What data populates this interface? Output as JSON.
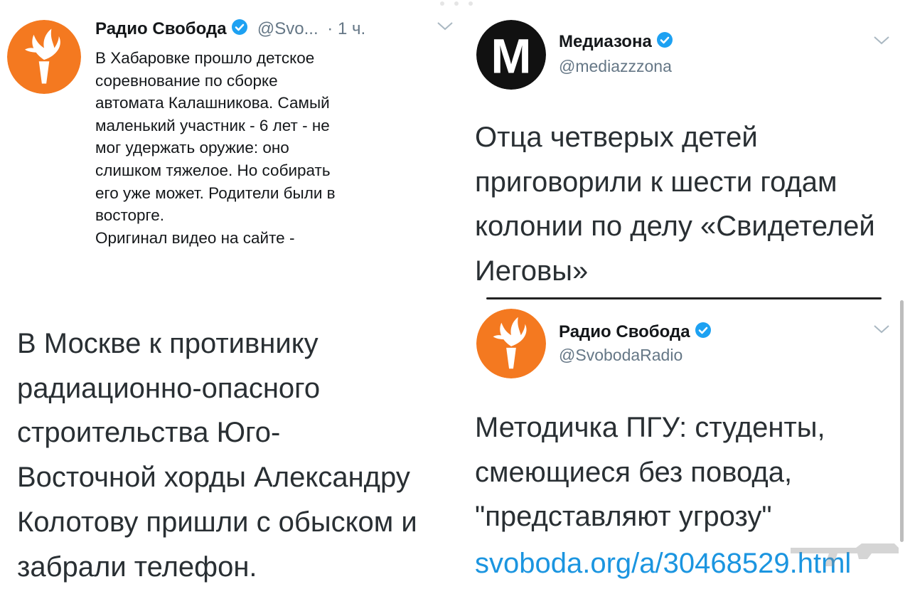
{
  "tweet_left": {
    "author_name": "Радио Свобода",
    "handle": "@Svo...",
    "time": "· 1 ч.",
    "body": [
      "В Хабаровке прошло детское",
      "соревнование по сборке",
      "автомата Калашникова. Самый",
      "маленький участник - 6 лет - не",
      "мог удержать оружие: оно",
      "слишком тяжелое. Но собирать",
      "его уже может. Родители были в",
      "восторге.",
      "Оригинал видео на сайте -"
    ]
  },
  "left_big_text": [
    "В Москве к противнику",
    "радиационно-опасного",
    "строительства Юго-",
    "Восточной хорды Александру",
    "Колотову пришли с обыском и",
    "забрали телефон."
  ],
  "tweet_right_top": {
    "author_name": "Медиазона",
    "handle": "@mediazzzona",
    "avatar_letter": "M",
    "body": [
      "Отца четверых детей",
      "приговорили к шести годам",
      "колонии по делу «Свидетелей",
      "Иеговы»"
    ]
  },
  "tweet_right_bottom": {
    "author_name": "Радио Свобода",
    "handle": "@SvobodaRadio",
    "body": [
      "Методичка ПГУ: студенты,",
      "смеющиеся без повода,",
      "\"представляют угрозу\""
    ],
    "link": "svoboda.org/a/30468529.html"
  },
  "colors": {
    "svoboda_orange": "#f47920",
    "verified_blue": "#1da1f2",
    "link_blue": "#1b95e0"
  },
  "icons": [
    "verified-badge-icon",
    "chevron-down-icon",
    "torch-logo-icon"
  ]
}
